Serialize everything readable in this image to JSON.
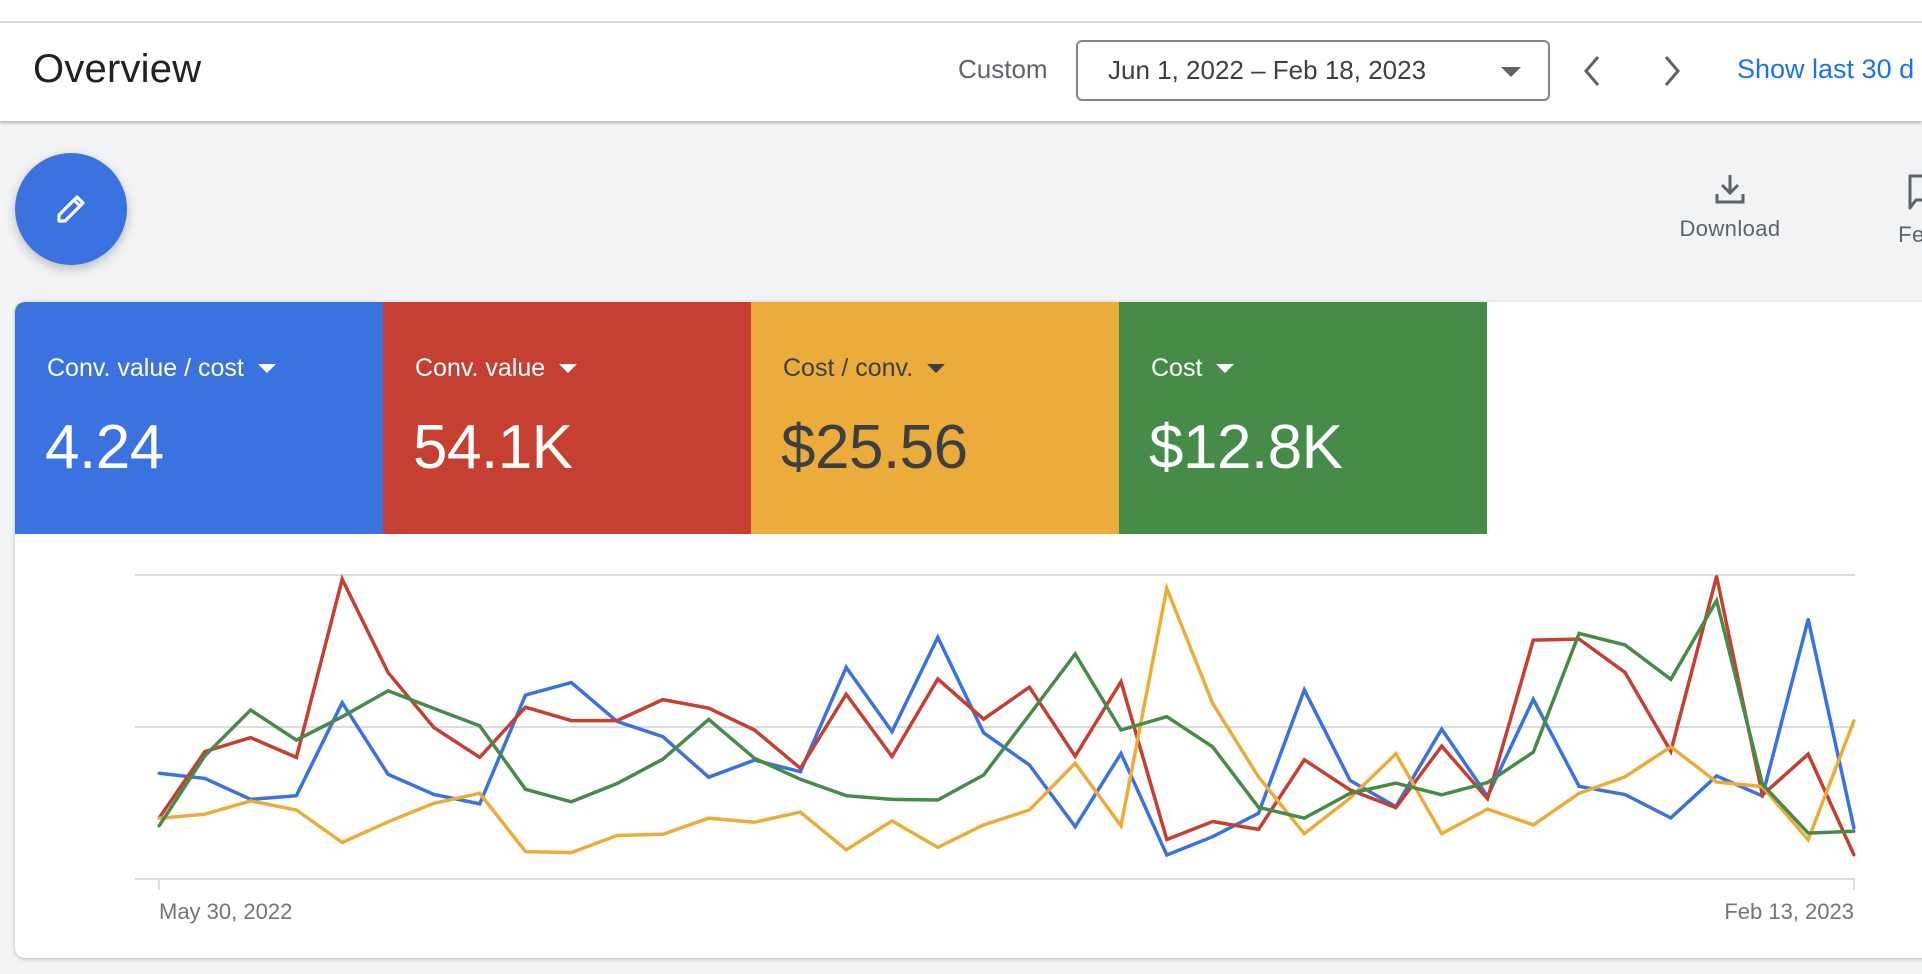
{
  "header": {
    "title": "Overview",
    "date_range_label": "Custom",
    "date_range_value": "Jun 1, 2022 – Feb 18, 2023",
    "show_last_link": "Show last 30 d"
  },
  "icons": {
    "fab": "pencil-icon",
    "prev": "chevron-left-icon",
    "next": "chevron-right-icon",
    "download": "download-icon",
    "feedback": "feedback-icon"
  },
  "toolbar": {
    "download_label": "Download",
    "feedback_label": "Feed"
  },
  "metrics": [
    {
      "label": "Conv. value / cost",
      "value": "4.24",
      "color": "#3a73df",
      "text_color": "#ffffff"
    },
    {
      "label": "Conv. value",
      "value": "54.1K",
      "color": "#c54031",
      "text_color": "#ffffff"
    },
    {
      "label": "Cost / conv.",
      "value": "$25.56",
      "color": "#ecac3b",
      "text_color": "#3c4043"
    },
    {
      "label": "Cost",
      "value": "$12.8K",
      "color": "#468c48",
      "text_color": "#ffffff"
    }
  ],
  "chart_data": {
    "type": "line",
    "title": "",
    "xlabel": "",
    "ylabel": "",
    "x_tick_labels": [
      "May 30, 2022",
      "Feb 13, 2023"
    ],
    "x_range": [
      "May 30, 2022",
      "Feb 13, 2023"
    ],
    "points_count": 38,
    "ylim": [
      0,
      100
    ],
    "y_units": "normalized (each metric on its own hidden axis)",
    "grid": true,
    "legend": "metric tiles above chart",
    "series": [
      {
        "name": "Conv. value / cost",
        "color": "#3a73df",
        "values": [
          34.8,
          33.1,
          26.2,
          27.4,
          58.0,
          34.4,
          27.8,
          24.7,
          60.5,
          64.6,
          51.8,
          46.8,
          33.5,
          39.1,
          35.3,
          69.6,
          48.5,
          79.5,
          48.1,
          37.5,
          17.2,
          41.3,
          7.9,
          13.9,
          21.6,
          62.2,
          32.4,
          23.8,
          49.3,
          27.2,
          59.1,
          30.5,
          27.8,
          20.1,
          33.9,
          27.3,
          85.4,
          16.7
        ]
      },
      {
        "name": "Conv. value",
        "color": "#c54031",
        "values": [
          20.0,
          41.9,
          46.5,
          40.0,
          98.6,
          67.9,
          49.8,
          40.0,
          56.5,
          52.1,
          52.1,
          59.0,
          56.2,
          49.0,
          36.4,
          60.8,
          40.3,
          65.8,
          52.6,
          63.1,
          40.4,
          64.9,
          13.0,
          18.9,
          16.3,
          39.2,
          29.3,
          23.5,
          43.7,
          26.4,
          78.6,
          78.9,
          68.0,
          42.0,
          99.5,
          27.6,
          41.1,
          7.9
        ]
      },
      {
        "name": "Cost / conv.",
        "color": "#ecac3b",
        "values": [
          20.0,
          21.3,
          25.7,
          22.7,
          12.0,
          18.8,
          24.9,
          28.2,
          9.0,
          8.7,
          14.3,
          14.7,
          20.0,
          18.7,
          22.0,
          9.6,
          19.1,
          10.4,
          17.8,
          22.7,
          38.1,
          17.5,
          95.6,
          57.8,
          33.6,
          14.9,
          26.6,
          41.2,
          14.9,
          23.0,
          17.8,
          28.2,
          33.6,
          43.5,
          31.9,
          30.4,
          12.9,
          52.1
        ]
      },
      {
        "name": "Cost",
        "color": "#468c48",
        "values": [
          17.4,
          40.5,
          55.6,
          45.7,
          53.4,
          61.9,
          56.1,
          50.4,
          29.5,
          25.4,
          31.4,
          39.4,
          52.5,
          39.7,
          32.8,
          27.4,
          26.2,
          26.0,
          34.2,
          54.0,
          74.0,
          49.0,
          53.4,
          43.5,
          23.6,
          20.0,
          28.2,
          31.5,
          27.7,
          31.7,
          41.7,
          80.8,
          77.0,
          65.7,
          91.6,
          31.2,
          15.1,
          15.7
        ]
      }
    ]
  }
}
